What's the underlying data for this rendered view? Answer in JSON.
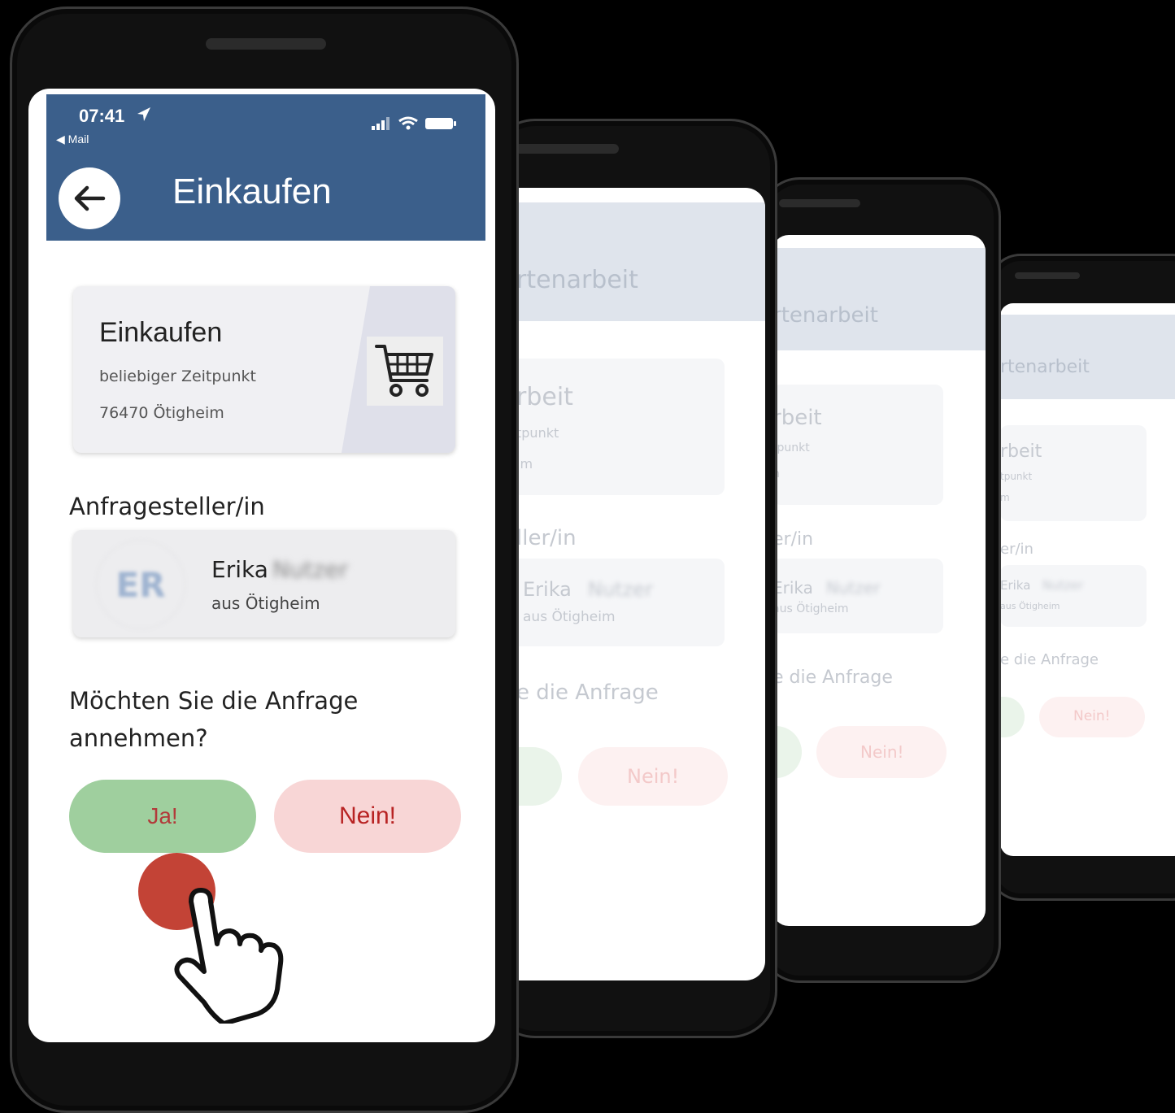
{
  "status_bar": {
    "time": "07:41",
    "back_app": "◀ Mail"
  },
  "header": {
    "title": "Einkaufen",
    "back_icon": "arrow-left-icon"
  },
  "task": {
    "name": "Einkaufen",
    "time": "beliebiger Zeitpunkt",
    "location": "76470 Ötigheim",
    "icon": "shopping-cart-icon"
  },
  "requester": {
    "section_label": "Anfragesteller/in",
    "initials": "ER",
    "first_name": "Erika",
    "last_name": "Nutzer",
    "town": "aus Ötigheim"
  },
  "question": "Möchten Sie die Anfrage annehmen?",
  "buttons": {
    "yes": "Ja!",
    "no": "Nein!"
  },
  "ghost_phones": [
    {
      "header_title": "rtenarbeit",
      "card_title": "rbeit",
      "card_line1": "tpunkt",
      "card_line2": "im",
      "label": "ller/in",
      "user": "Erika",
      "user_last": "Nutzer",
      "town": "aus Ötigheim",
      "question": "e die Anfrage",
      "no": "Nein!"
    },
    {
      "header_title": "rtenarbeit",
      "card_title": "rbeit",
      "card_line1": "tpunkt",
      "card_line2": "n",
      "label": "er/in",
      "user": "Erika",
      "user_last": "Nutzer",
      "town": "aus Ötigheim",
      "question": "e die Anfrage",
      "no": "Nein!"
    },
    {
      "header_title": "rtenarbeit",
      "card_title": "rbeit",
      "card_line1": "tpunkt",
      "card_line2": "m",
      "label": "er/in",
      "user": "Erika",
      "user_last": "Nutzer",
      "town": "aus Ötigheim",
      "question": "e die Anfrage",
      "no": "Nein!"
    }
  ],
  "colors": {
    "header": "#3b5f8b",
    "yes": "#9fcf9e",
    "no": "#f8d6d6",
    "no_text": "#b82323",
    "touch": "#c0392b"
  }
}
